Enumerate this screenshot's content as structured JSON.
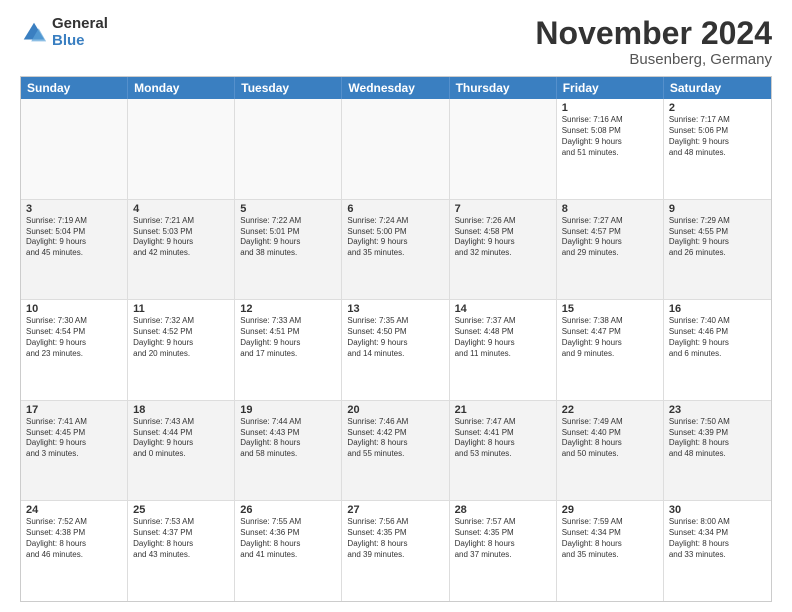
{
  "logo": {
    "general": "General",
    "blue": "Blue"
  },
  "title": "November 2024",
  "subtitle": "Busenberg, Germany",
  "days": [
    "Sunday",
    "Monday",
    "Tuesday",
    "Wednesday",
    "Thursday",
    "Friday",
    "Saturday"
  ],
  "rows": [
    [
      {
        "day": "",
        "info": ""
      },
      {
        "day": "",
        "info": ""
      },
      {
        "day": "",
        "info": ""
      },
      {
        "day": "",
        "info": ""
      },
      {
        "day": "",
        "info": ""
      },
      {
        "day": "1",
        "info": "Sunrise: 7:16 AM\nSunset: 5:08 PM\nDaylight: 9 hours\nand 51 minutes."
      },
      {
        "day": "2",
        "info": "Sunrise: 7:17 AM\nSunset: 5:06 PM\nDaylight: 9 hours\nand 48 minutes."
      }
    ],
    [
      {
        "day": "3",
        "info": "Sunrise: 7:19 AM\nSunset: 5:04 PM\nDaylight: 9 hours\nand 45 minutes."
      },
      {
        "day": "4",
        "info": "Sunrise: 7:21 AM\nSunset: 5:03 PM\nDaylight: 9 hours\nand 42 minutes."
      },
      {
        "day": "5",
        "info": "Sunrise: 7:22 AM\nSunset: 5:01 PM\nDaylight: 9 hours\nand 38 minutes."
      },
      {
        "day": "6",
        "info": "Sunrise: 7:24 AM\nSunset: 5:00 PM\nDaylight: 9 hours\nand 35 minutes."
      },
      {
        "day": "7",
        "info": "Sunrise: 7:26 AM\nSunset: 4:58 PM\nDaylight: 9 hours\nand 32 minutes."
      },
      {
        "day": "8",
        "info": "Sunrise: 7:27 AM\nSunset: 4:57 PM\nDaylight: 9 hours\nand 29 minutes."
      },
      {
        "day": "9",
        "info": "Sunrise: 7:29 AM\nSunset: 4:55 PM\nDaylight: 9 hours\nand 26 minutes."
      }
    ],
    [
      {
        "day": "10",
        "info": "Sunrise: 7:30 AM\nSunset: 4:54 PM\nDaylight: 9 hours\nand 23 minutes."
      },
      {
        "day": "11",
        "info": "Sunrise: 7:32 AM\nSunset: 4:52 PM\nDaylight: 9 hours\nand 20 minutes."
      },
      {
        "day": "12",
        "info": "Sunrise: 7:33 AM\nSunset: 4:51 PM\nDaylight: 9 hours\nand 17 minutes."
      },
      {
        "day": "13",
        "info": "Sunrise: 7:35 AM\nSunset: 4:50 PM\nDaylight: 9 hours\nand 14 minutes."
      },
      {
        "day": "14",
        "info": "Sunrise: 7:37 AM\nSunset: 4:48 PM\nDaylight: 9 hours\nand 11 minutes."
      },
      {
        "day": "15",
        "info": "Sunrise: 7:38 AM\nSunset: 4:47 PM\nDaylight: 9 hours\nand 9 minutes."
      },
      {
        "day": "16",
        "info": "Sunrise: 7:40 AM\nSunset: 4:46 PM\nDaylight: 9 hours\nand 6 minutes."
      }
    ],
    [
      {
        "day": "17",
        "info": "Sunrise: 7:41 AM\nSunset: 4:45 PM\nDaylight: 9 hours\nand 3 minutes."
      },
      {
        "day": "18",
        "info": "Sunrise: 7:43 AM\nSunset: 4:44 PM\nDaylight: 9 hours\nand 0 minutes."
      },
      {
        "day": "19",
        "info": "Sunrise: 7:44 AM\nSunset: 4:43 PM\nDaylight: 8 hours\nand 58 minutes."
      },
      {
        "day": "20",
        "info": "Sunrise: 7:46 AM\nSunset: 4:42 PM\nDaylight: 8 hours\nand 55 minutes."
      },
      {
        "day": "21",
        "info": "Sunrise: 7:47 AM\nSunset: 4:41 PM\nDaylight: 8 hours\nand 53 minutes."
      },
      {
        "day": "22",
        "info": "Sunrise: 7:49 AM\nSunset: 4:40 PM\nDaylight: 8 hours\nand 50 minutes."
      },
      {
        "day": "23",
        "info": "Sunrise: 7:50 AM\nSunset: 4:39 PM\nDaylight: 8 hours\nand 48 minutes."
      }
    ],
    [
      {
        "day": "24",
        "info": "Sunrise: 7:52 AM\nSunset: 4:38 PM\nDaylight: 8 hours\nand 46 minutes."
      },
      {
        "day": "25",
        "info": "Sunrise: 7:53 AM\nSunset: 4:37 PM\nDaylight: 8 hours\nand 43 minutes."
      },
      {
        "day": "26",
        "info": "Sunrise: 7:55 AM\nSunset: 4:36 PM\nDaylight: 8 hours\nand 41 minutes."
      },
      {
        "day": "27",
        "info": "Sunrise: 7:56 AM\nSunset: 4:35 PM\nDaylight: 8 hours\nand 39 minutes."
      },
      {
        "day": "28",
        "info": "Sunrise: 7:57 AM\nSunset: 4:35 PM\nDaylight: 8 hours\nand 37 minutes."
      },
      {
        "day": "29",
        "info": "Sunrise: 7:59 AM\nSunset: 4:34 PM\nDaylight: 8 hours\nand 35 minutes."
      },
      {
        "day": "30",
        "info": "Sunrise: 8:00 AM\nSunset: 4:34 PM\nDaylight: 8 hours\nand 33 minutes."
      }
    ]
  ]
}
